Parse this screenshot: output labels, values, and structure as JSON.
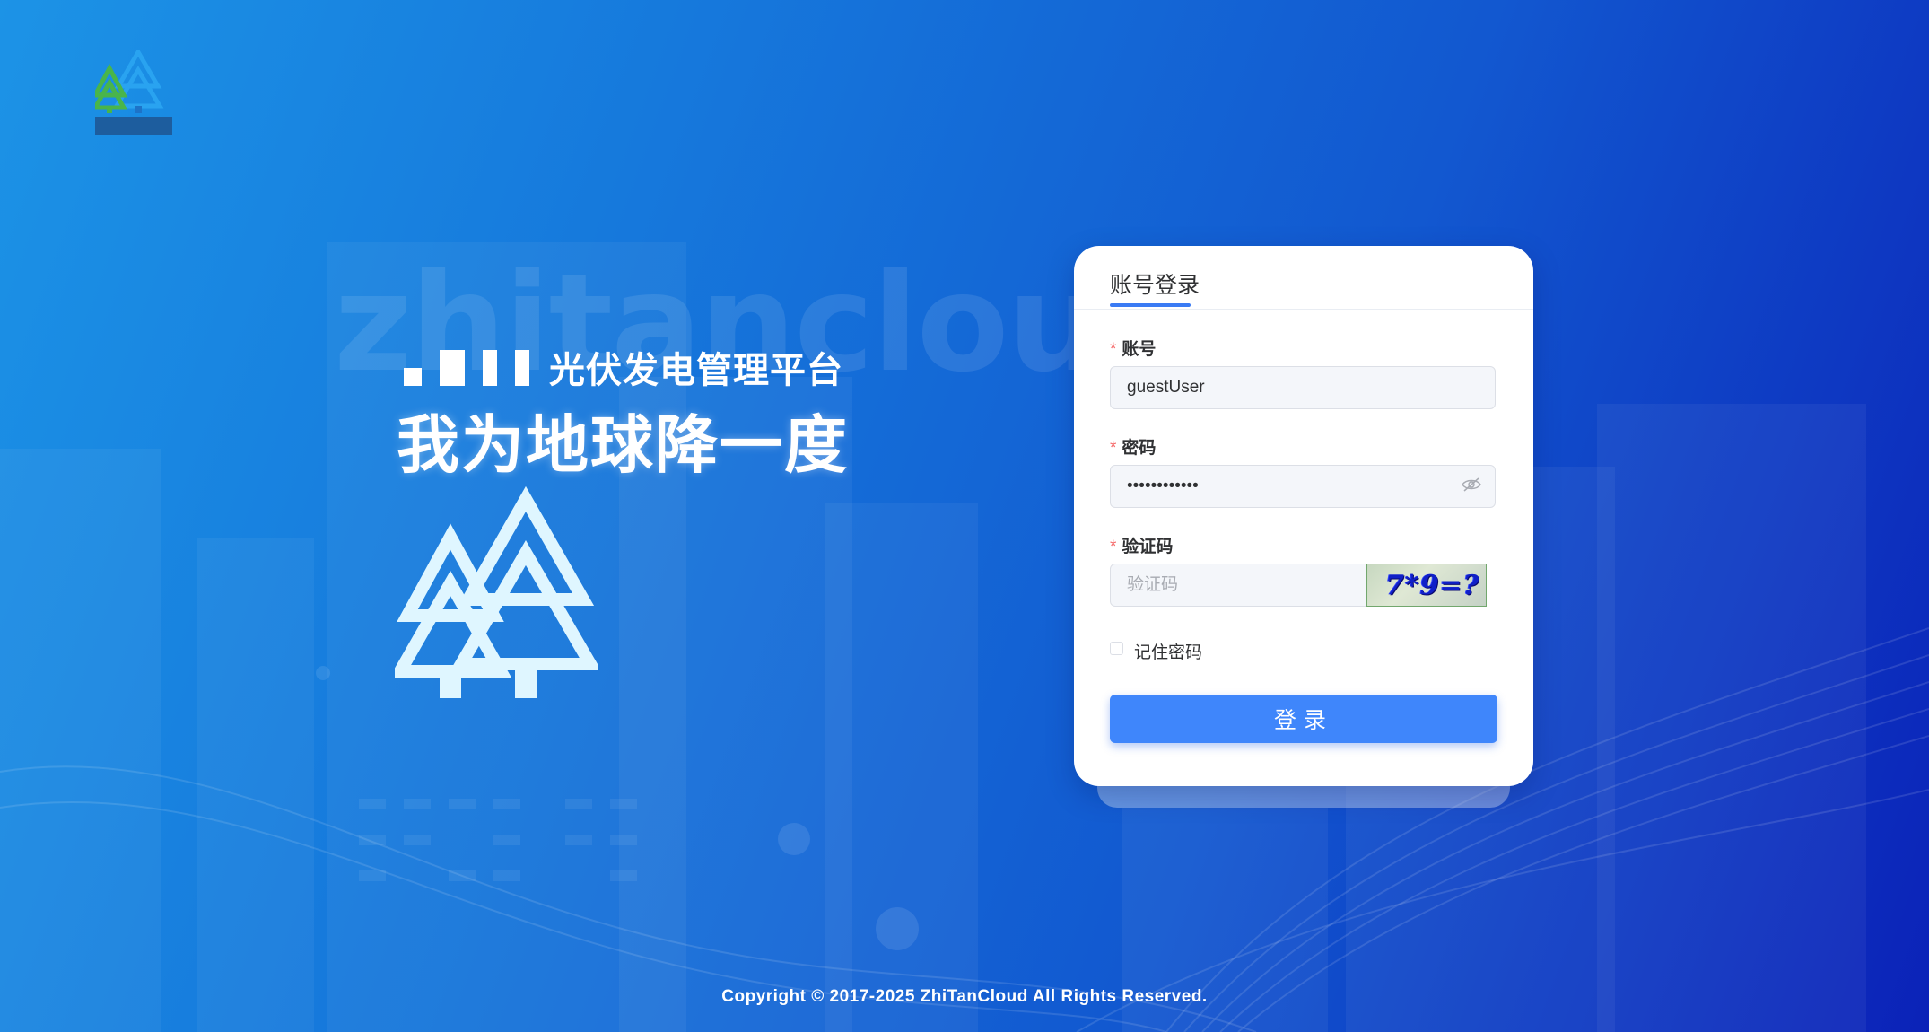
{
  "brand": {
    "watermark": "zhitancloud",
    "platform_name": "光伏发电管理平台",
    "slogan": "我为地球降一度"
  },
  "login": {
    "tab_label": "账号登录",
    "account": {
      "label": "账号",
      "value": "guestUser"
    },
    "password": {
      "label": "密码",
      "value": "••••••••••••"
    },
    "captcha": {
      "label": "验证码",
      "placeholder": "验证码",
      "image_text": "7*9=?"
    },
    "remember_label": "记住密码",
    "submit_label": "登录"
  },
  "footer": {
    "copyright": "Copyright © 2017-2025 ZhiTanCloud All Rights Reserved."
  },
  "icons": {
    "logo": "zhitan-tree-logo",
    "eye": "eye-off-icon",
    "trees": "trees-icon"
  },
  "colors": {
    "primary": "#3f86fb",
    "bg_left": "#1c93e6",
    "bg_right": "#0b22b8",
    "required_star": "#f56c6c"
  }
}
